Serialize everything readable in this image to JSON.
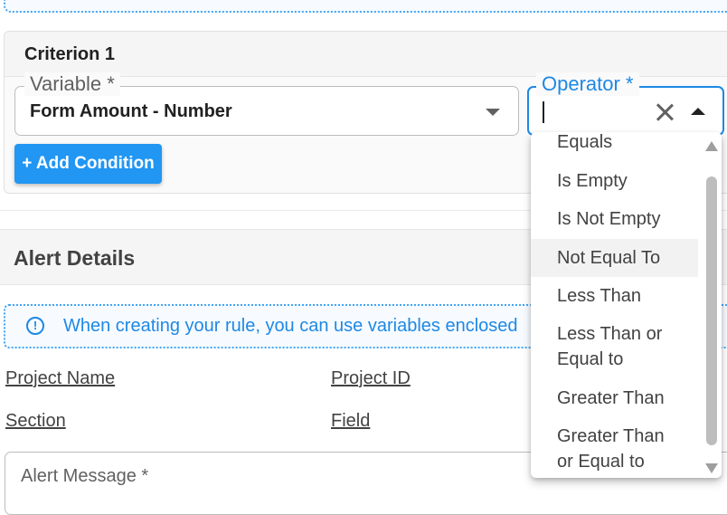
{
  "criterion": {
    "title": "Criterion 1",
    "variable_label": "Variable *",
    "variable_value": "Form Amount - Number",
    "operator_label": "Operator *",
    "add_condition_label": "+ Add Condition"
  },
  "operator_dropdown": {
    "options": [
      "Equals",
      "Is Empty",
      "Is Not Empty",
      "Not Equal To",
      "Less Than",
      "Less Than or Equal to",
      "Greater Than",
      "Greater Than or Equal to"
    ],
    "hovered": "Not Equal To"
  },
  "alert": {
    "title": "Alert Details",
    "info_text": "When creating your rule, you can use variables enclosed",
    "variables": [
      "Project Name",
      "Project ID",
      "Section",
      "Field"
    ],
    "message_label": "Alert Message *"
  },
  "colors": {
    "accent": "#1e88e5",
    "button": "#2196f3"
  },
  "icons": [
    "info-icon",
    "clear-icon",
    "chevron-down-icon",
    "chevron-up-icon"
  ]
}
